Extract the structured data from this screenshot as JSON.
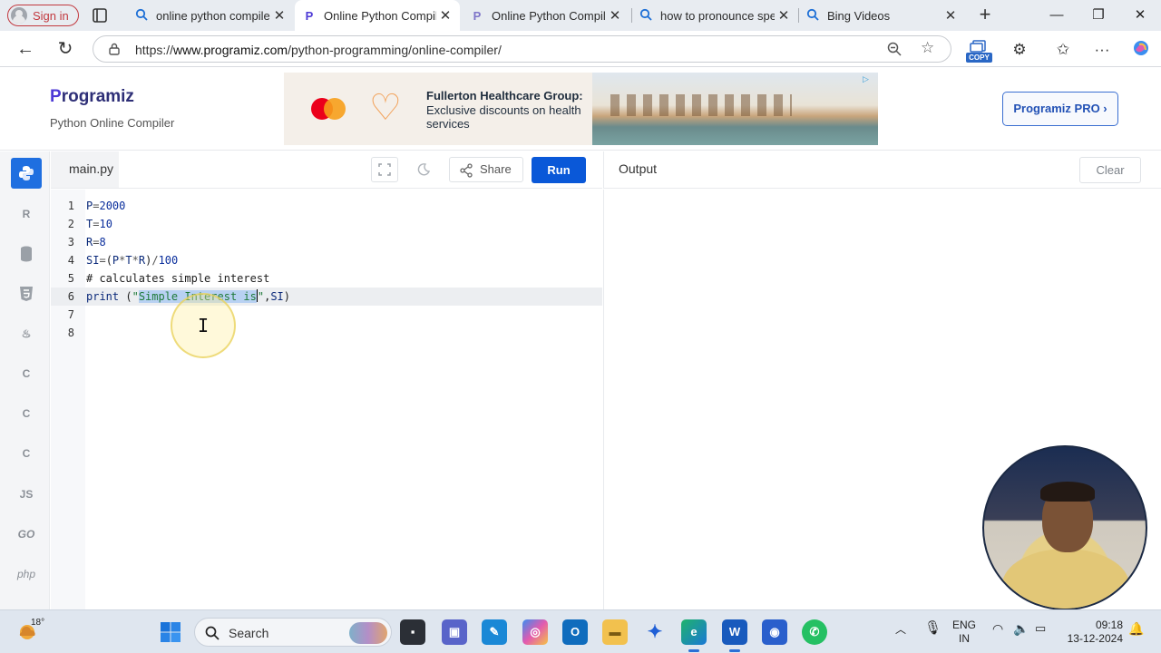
{
  "browser": {
    "signin_label": "Sign in",
    "tabs": [
      {
        "title": "online python compiler",
        "icon": "search-icon"
      },
      {
        "title": "Online Python Compile",
        "icon": "programiz-icon",
        "active": true
      },
      {
        "title": "Online Python Compile",
        "icon": "programiz-icon"
      },
      {
        "title": "how to pronounce spe",
        "icon": "search-icon"
      },
      {
        "title": "Bing Videos",
        "icon": "search-icon"
      }
    ],
    "url_prefix": "https://",
    "url_host": "www.programiz.com",
    "url_path": "/python-programming/online-compiler/",
    "copy_badge": "COPY"
  },
  "site": {
    "logo": "rogramiz",
    "logo_p": "P",
    "subtitle": "Python Online Compiler",
    "ad_title": "Fullerton Healthcare Group:",
    "ad_text": "Exclusive discounts on health services",
    "pro_button": "Programiz PRO ›"
  },
  "languages": [
    "python",
    "r",
    "sql",
    "html",
    "java",
    "c",
    "cpp",
    "csharp",
    "JS",
    "GO",
    "php"
  ],
  "editor": {
    "filename": "main.py",
    "share_label": "Share",
    "run_label": "Run",
    "lines": [
      "P=2000",
      "T=10",
      "R=8",
      "SI=(P*T*R)/100",
      "# calculates simple interest",
      "print (\"Simple Interest is\",SI)",
      "",
      ""
    ],
    "current_line": 6,
    "selected_text": "Simple Interest is"
  },
  "output": {
    "title": "Output",
    "clear_label": "Clear",
    "content": ""
  },
  "taskbar": {
    "temperature": "18°",
    "search_label": "Search",
    "lang_line1": "ENG",
    "lang_line2": "IN",
    "time": "09:18",
    "date": "13-12-2024"
  }
}
